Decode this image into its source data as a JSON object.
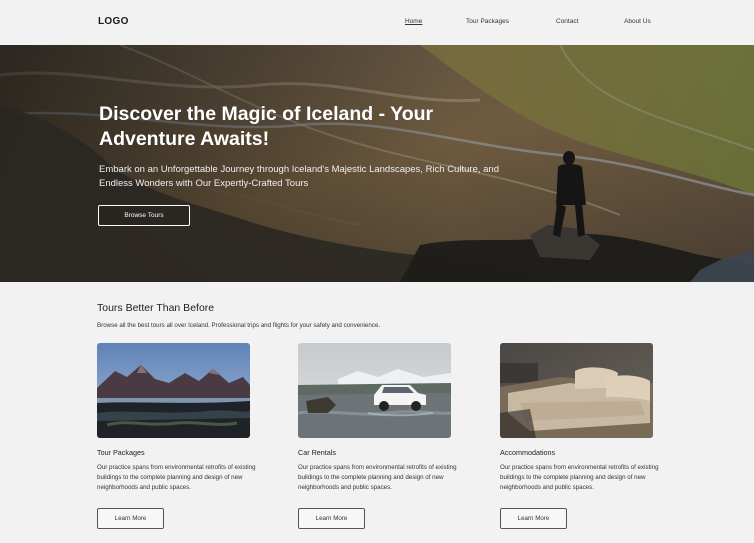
{
  "header": {
    "logo": "LOGO",
    "nav": [
      {
        "label": "Home",
        "active": true
      },
      {
        "label": "Tour Packages"
      },
      {
        "label": "Contact"
      },
      {
        "label": "About Us"
      }
    ]
  },
  "hero": {
    "title": "Discover the Magic of Iceland - Your Adventure Awaits!",
    "subtitle": "Embark on an Unforgettable Journey through Iceland's Majestic Landscapes, Rich Culture, and Endless Wonders with Our Expertly-Crafted Tours",
    "button": "Browse Tours"
  },
  "section": {
    "title": "Tours Better Than Before",
    "description": "Browse all the best tours all over Iceland. Professional trips and flights for your safety and convenience."
  },
  "cards": [
    {
      "title": "Tour Packages",
      "text": "Our practice spans from environmental retrofits of existing buildings to the complete planning and design of new neighborhoods and public spaces.",
      "button": "Learn More",
      "image": "mountain-landscape-photo"
    },
    {
      "title": "Car Rentals",
      "text": "Our practice spans from environmental retrofits of existing buildings to the complete planning and design of new neighborhoods and public spaces.",
      "button": "Learn More",
      "image": "white-suv-photo"
    },
    {
      "title": "Accommodations",
      "text": "Our practice spans from environmental retrofits of existing buildings to the complete planning and design of new neighborhoods and public spaces.",
      "button": "Learn More",
      "image": "hotel-bed-photo"
    }
  ]
}
